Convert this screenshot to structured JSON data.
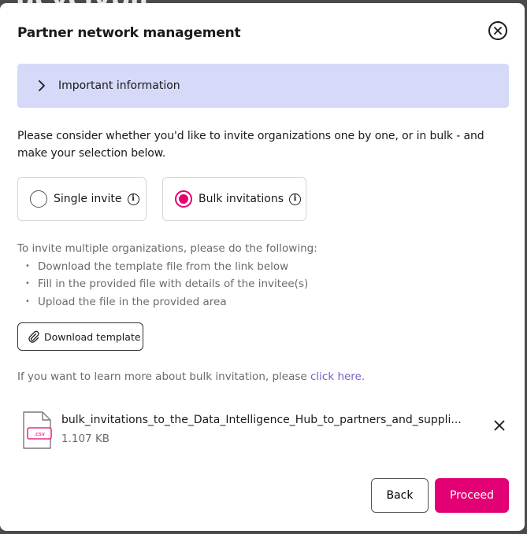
{
  "backdrop": {
    "title_fragment": "ucvcivpii"
  },
  "modal": {
    "title": "Partner network management",
    "close_icon": "close-circle-icon"
  },
  "info_panel": {
    "label": "Important information",
    "icon": "chevron-right-icon",
    "background": "#d6d9f8"
  },
  "description": "Please consider whether you'd like to invite organizations one by one, or in bulk - and make your selection below.",
  "invite_options": [
    {
      "label": "Single invite",
      "selected": false
    },
    {
      "label": "Bulk invitations",
      "selected": true
    }
  ],
  "instructions": {
    "intro": "To invite multiple organizations, please do the following:",
    "steps": [
      "Download the template file from the link below",
      "Fill in the provided file with details of the invitee(s)",
      "Upload the file in the provided area"
    ]
  },
  "download_button": {
    "label": "Download template",
    "icon": "paperclip-icon"
  },
  "learn_more": {
    "text": "If you want to learn more about bulk invitation, please ",
    "link": "click here."
  },
  "uploaded_file": {
    "name": "bulk_invitations_to_the_Data_Intelligence_Hub_to_partners_and_suppli...",
    "size": "1.107 KB",
    "type_badge": ".csv",
    "icon": "csv-file-icon"
  },
  "footer": {
    "back_label": "Back",
    "proceed_label": "Proceed"
  },
  "colors": {
    "accent": "#e20074",
    "link": "#7a5cc8"
  }
}
